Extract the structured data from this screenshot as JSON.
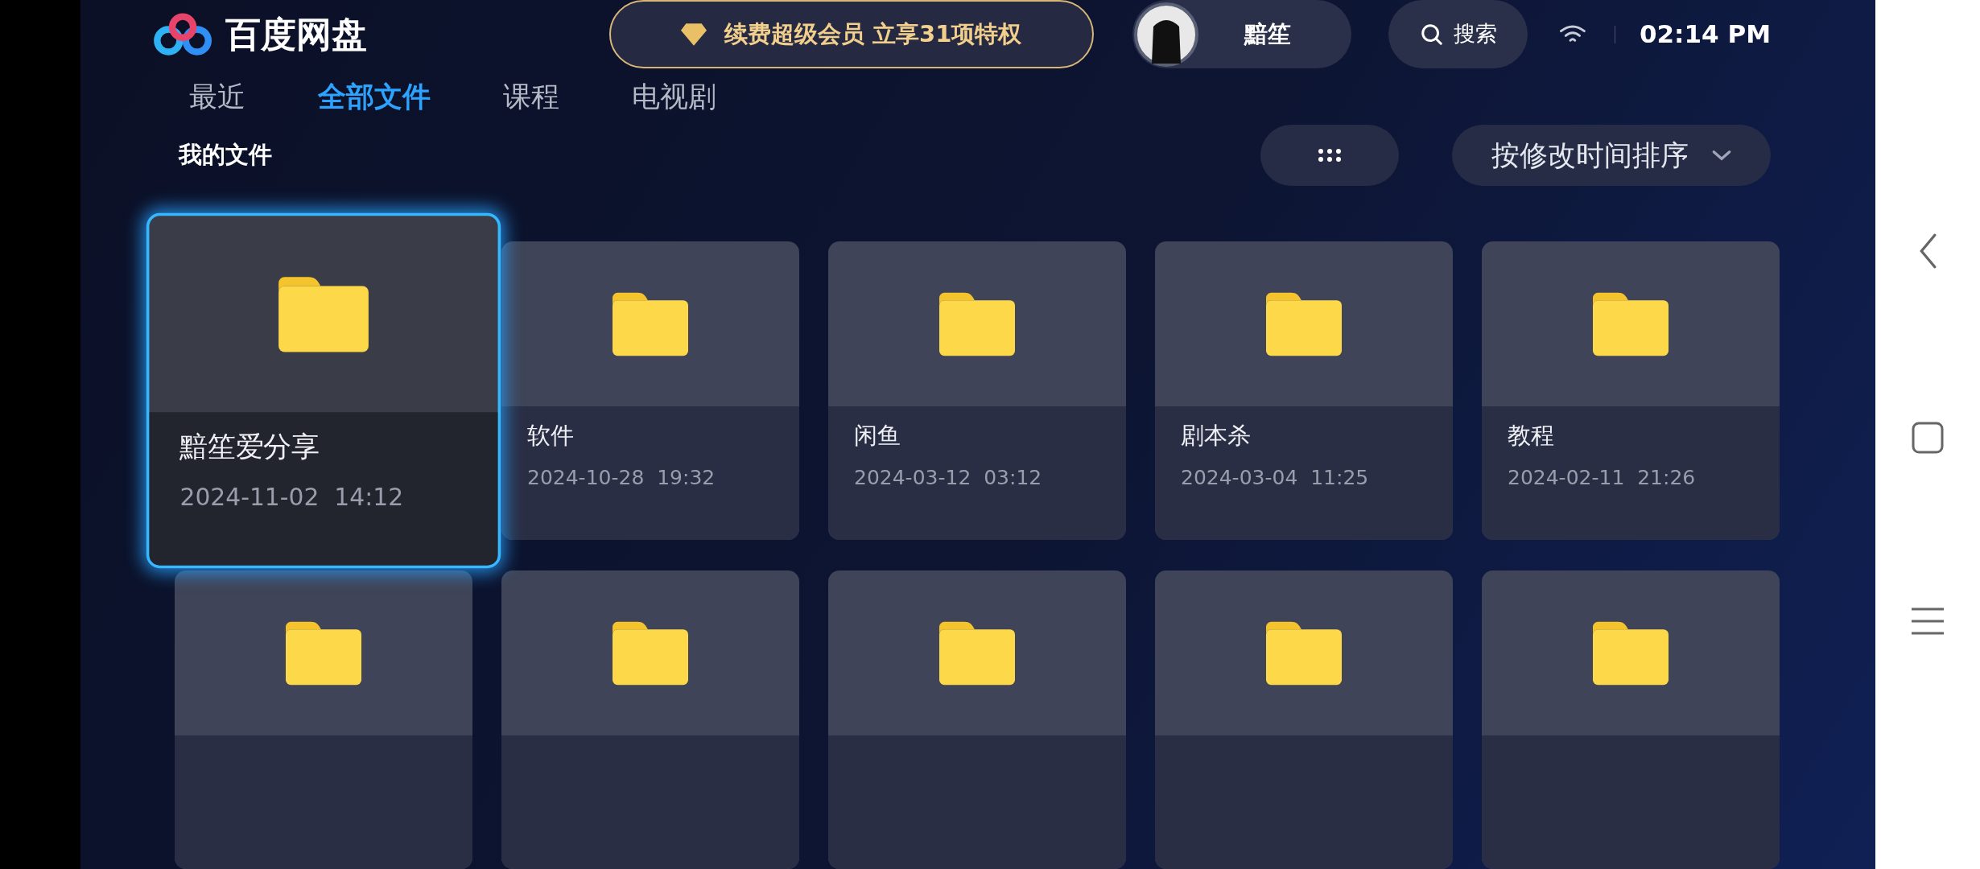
{
  "header": {
    "logo_text": "百度网盘",
    "vip_banner": "续费超级会员 立享31项特权",
    "user": {
      "name": "黯笙"
    },
    "search": {
      "label": "搜索"
    },
    "time": "02:14 PM"
  },
  "tabs": [
    {
      "label": "最近",
      "selected": false
    },
    {
      "label": "全部文件",
      "selected": true
    },
    {
      "label": "课程",
      "selected": false
    },
    {
      "label": "电视剧",
      "selected": false
    }
  ],
  "section_title": "我的文件",
  "sort": {
    "label": "按修改时间排序"
  },
  "files": [
    {
      "name": "黯笙爱分享",
      "date": "2024-11-02",
      "time": "14:12",
      "selected": true
    },
    {
      "name": "软件",
      "date": "2024-10-28",
      "time": "19:32",
      "selected": false
    },
    {
      "name": "闲鱼",
      "date": "2024-03-12",
      "time": "03:12",
      "selected": false
    },
    {
      "name": "剧本杀",
      "date": "2024-03-04",
      "time": "11:25",
      "selected": false
    },
    {
      "name": "教程",
      "date": "2024-02-11",
      "time": "21:26",
      "selected": false
    },
    {
      "selected": false
    },
    {
      "selected": false
    },
    {
      "selected": false
    },
    {
      "selected": false
    },
    {
      "selected": false
    }
  ]
}
